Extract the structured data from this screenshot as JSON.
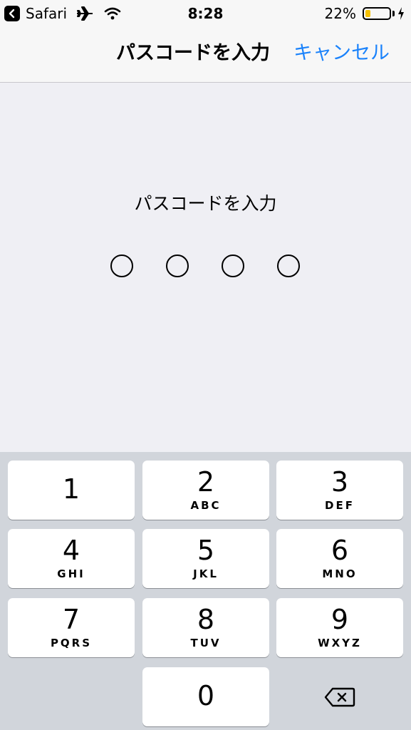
{
  "status_bar": {
    "back_app": "Safari",
    "time": "8:28",
    "battery_percent": "22%",
    "battery_level": 0.22,
    "icons": [
      "back-chevron-icon",
      "airplane-icon",
      "wifi-icon",
      "battery-icon",
      "charging-bolt-icon"
    ]
  },
  "navbar": {
    "title": "パスコードを入力",
    "cancel_label": "キャンセル",
    "cancel_color": "#1a82fb"
  },
  "passcode": {
    "prompt": "パスコードを入力",
    "digits_total": 4,
    "digits_entered": 0
  },
  "keypad": {
    "keys": [
      {
        "digit": "1",
        "letters": ""
      },
      {
        "digit": "2",
        "letters": "ABC"
      },
      {
        "digit": "3",
        "letters": "DEF"
      },
      {
        "digit": "4",
        "letters": "GHI"
      },
      {
        "digit": "5",
        "letters": "JKL"
      },
      {
        "digit": "6",
        "letters": "MNO"
      },
      {
        "digit": "7",
        "letters": "PQRS"
      },
      {
        "digit": "8",
        "letters": "TUV"
      },
      {
        "digit": "9",
        "letters": "WXYZ"
      },
      {
        "digit": "0",
        "letters": ""
      }
    ],
    "delete_icon": "delete-backspace-icon"
  },
  "colors": {
    "background": "#efeff4",
    "keypad_background": "#d1d5db",
    "battery_fill": "#f5c000"
  }
}
